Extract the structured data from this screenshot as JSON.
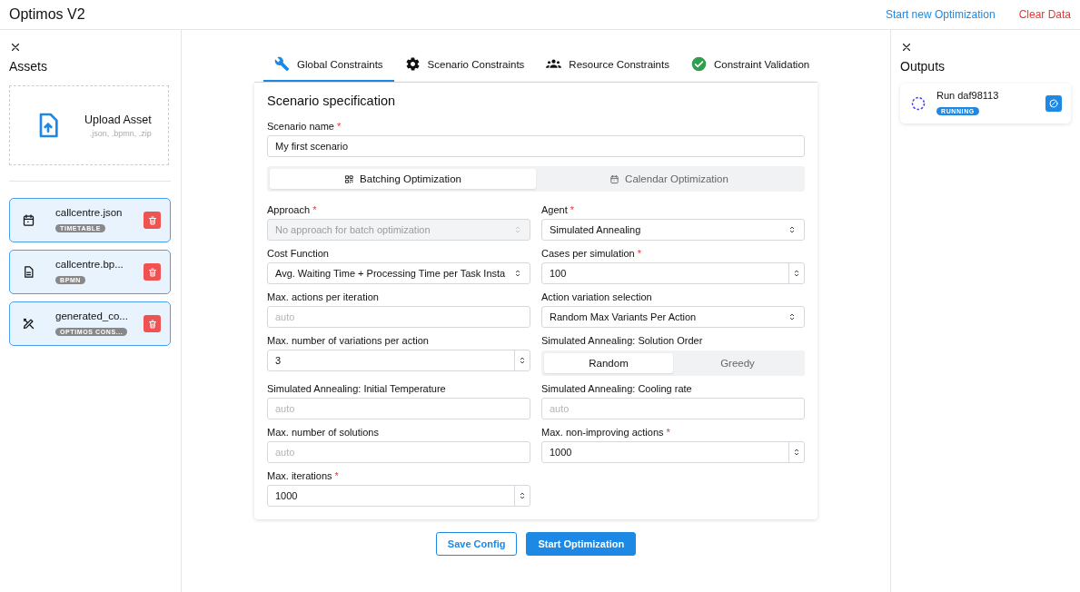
{
  "header": {
    "title": "Optimos V2",
    "actions": [
      {
        "label": "Start new Optimization",
        "kind": "primary"
      },
      {
        "label": "Clear Data",
        "kind": "danger"
      }
    ]
  },
  "assets": {
    "title": "Assets",
    "upload": {
      "label": "Upload Asset",
      "hint": ".json, .bpmn, .zip"
    },
    "items": [
      {
        "name": "callcentre.json",
        "badge": "TIMETABLE",
        "kind": "calendar",
        "selected": true
      },
      {
        "name": "callcentre.bp...",
        "badge": "BPMN",
        "kind": "document",
        "selected": true
      },
      {
        "name": "generated_co...",
        "badge": "OPTIMOS CONS...",
        "kind": "tools",
        "selected": true
      }
    ]
  },
  "tabs": [
    {
      "label": "Global Constraints",
      "kind": "wrench",
      "selected": true
    },
    {
      "label": "Scenario Constraints",
      "kind": "gear",
      "selected": false
    },
    {
      "label": "Resource Constraints",
      "kind": "people",
      "selected": false
    },
    {
      "label": "Constraint Validation",
      "kind": "check",
      "selected": false
    }
  ],
  "form": {
    "title": "Scenario specification",
    "name_label": "Scenario name",
    "name_required_mark": "*",
    "name_value": "My first scenario",
    "modes": [
      {
        "label": "Batching Optimization",
        "kind": "grid",
        "selected": true
      },
      {
        "label": "Calendar Optimization",
        "kind": "calendar",
        "selected": false
      }
    ],
    "fields": [
      {
        "kind": "select",
        "label": "Approach",
        "required_mark": "*",
        "placeholder": "No approach for batch optimization",
        "disabled": true
      },
      {
        "kind": "select",
        "label": "Agent",
        "required_mark": "*",
        "value": "Simulated Annealing",
        "disabled": false
      },
      {
        "kind": "select",
        "label": "Cost Function",
        "value": "Avg. Waiting Time + Processing Time per Task Insta",
        "disabled": false
      },
      {
        "kind": "number",
        "label": "Cases per simulation",
        "required_mark": "*",
        "value": "100"
      },
      {
        "kind": "text",
        "label": "Max. actions per iteration",
        "placeholder": "auto"
      },
      {
        "kind": "select",
        "label": "Action variation selection",
        "value": "Random Max Variants Per Action",
        "disabled": false
      },
      {
        "kind": "number",
        "label": "Max. number of variations per action",
        "value": "3"
      },
      {
        "kind": "segmented",
        "label": "Simulated Annealing: Solution Order",
        "options": [
          {
            "label": "Random",
            "selected": true
          },
          {
            "label": "Greedy",
            "selected": false
          }
        ]
      },
      {
        "kind": "text",
        "label": "Simulated Annealing: Initial Temperature",
        "placeholder": "auto"
      },
      {
        "kind": "text",
        "label": "Simulated Annealing: Cooling rate",
        "placeholder": "auto"
      },
      {
        "kind": "text",
        "label": "Max. number of solutions",
        "placeholder": "auto"
      },
      {
        "kind": "number",
        "label": "Max. non-improving actions",
        "required_mark": "*",
        "value": "1000"
      },
      {
        "kind": "number",
        "label": "Max. iterations",
        "required_mark": "*",
        "value": "1000"
      }
    ]
  },
  "buttons": [
    {
      "label": "Save Config",
      "kind": "outline"
    },
    {
      "label": "Start Optimization",
      "kind": "filled"
    }
  ],
  "outputs": {
    "title": "Outputs",
    "runs": [
      {
        "name": "Run daf98113",
        "status": "RUNNING"
      }
    ]
  }
}
